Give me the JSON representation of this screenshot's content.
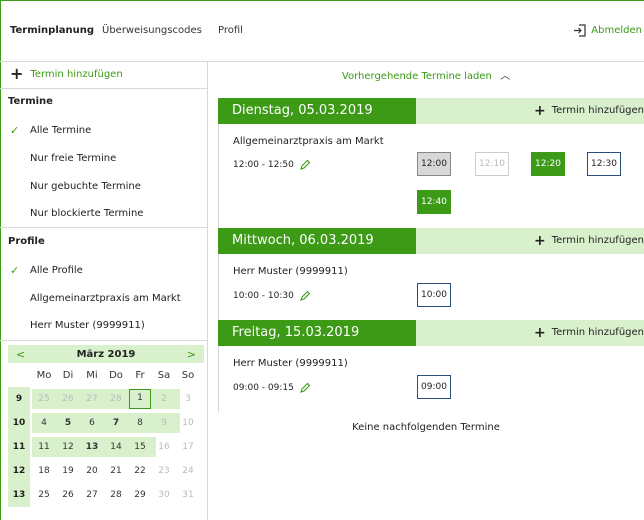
{
  "nav": {
    "items": [
      "Terminplanung",
      "Überweisungscodes",
      "Profil"
    ],
    "logout": "Abmelden"
  },
  "sidebar": {
    "add_label": "Termin hinzufügen",
    "termine_title": "Termine",
    "termine_filters": [
      "Alle Termine",
      "Nur freie Termine",
      "Nur gebuchte Termine",
      "Nur blockierte Termine"
    ],
    "profile_title": "Profile",
    "profile_filters": [
      "Alle Profile",
      "Allgemeinarztpraxis am Markt",
      "Herr Muster (9999911)"
    ]
  },
  "calendar": {
    "prev": "<",
    "next": ">",
    "month": "März 2019",
    "weekdays": [
      "Mo",
      "Di",
      "Mi",
      "Do",
      "Fr",
      "Sa",
      "So"
    ],
    "weeks": [
      {
        "wk": "9",
        "days": [
          "25",
          "26",
          "27",
          "28",
          "1",
          "2",
          "3"
        ]
      },
      {
        "wk": "10",
        "days": [
          "4",
          "5",
          "6",
          "7",
          "8",
          "9",
          "10"
        ]
      },
      {
        "wk": "11",
        "days": [
          "11",
          "12",
          "13",
          "14",
          "15",
          "16",
          "17"
        ]
      },
      {
        "wk": "12",
        "days": [
          "18",
          "19",
          "20",
          "21",
          "22",
          "23",
          "24"
        ]
      },
      {
        "wk": "13",
        "days": [
          "25",
          "26",
          "27",
          "28",
          "29",
          "30",
          "31"
        ]
      }
    ]
  },
  "main": {
    "load_prev": "Vorhergehende Termine laden",
    "add_label": "Termin hinzufügen",
    "days": [
      {
        "date": "Dienstag, 05.03.2019",
        "title": "Allgemeinarztpraxis am Markt",
        "time": "12:00 - 12:50",
        "slots": [
          "12:00",
          "12:10",
          "12:20",
          "12:30",
          "12:40"
        ]
      },
      {
        "date": "Mittwoch, 06.03.2019",
        "title": "Herr Muster (9999911)",
        "time": "10:00 - 10:30",
        "slots": [
          "10:00"
        ]
      },
      {
        "date": "Freitag, 15.03.2019",
        "title": "Herr Muster (9999911)",
        "time": "09:00 - 09:15",
        "slots": [
          "09:00"
        ]
      }
    ],
    "no_next": "Keine nachfolgenden Termine"
  },
  "colors": {
    "accent": "#3c9a16",
    "light_accent": "#d9f0cd",
    "slot_border": "#274f7a"
  }
}
